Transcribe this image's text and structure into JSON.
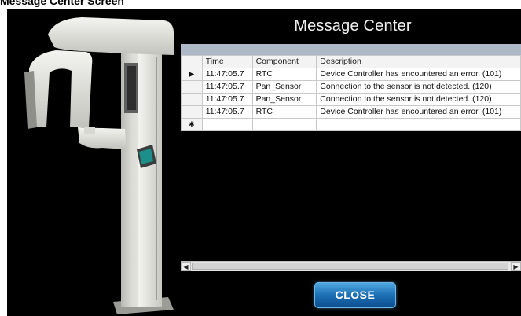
{
  "page_caption": "Message Center Screen",
  "window": {
    "title": "Message Center"
  },
  "grid": {
    "columns": [
      "Time",
      "Component",
      "Description"
    ],
    "rows": [
      {
        "indicator": "▶",
        "time": "11:47:05.7",
        "component": "RTC",
        "description": "Device Controller has encountered an error. (101)"
      },
      {
        "indicator": "",
        "time": "11:47:05.7",
        "component": "Pan_Sensor",
        "description": "Connection to the sensor is not detected. (120)"
      },
      {
        "indicator": "",
        "time": "11:47:05.7",
        "component": "Pan_Sensor",
        "description": "Connection to the sensor is not detected. (120)"
      },
      {
        "indicator": "",
        "time": "11:47:05.7",
        "component": "RTC",
        "description": "Device Controller has encountered an error. (101)"
      }
    ],
    "new_row_indicator": "✱"
  },
  "close_button": {
    "label": "CLOSE"
  },
  "icons": {
    "machine": "panoramic-xray-unit-image",
    "scroll_left": "scroll-left-icon",
    "scroll_right": "scroll-right-icon"
  },
  "colors": {
    "background": "#000000",
    "header_bar": "#aeb9c7",
    "button": "#1c6fb4"
  }
}
